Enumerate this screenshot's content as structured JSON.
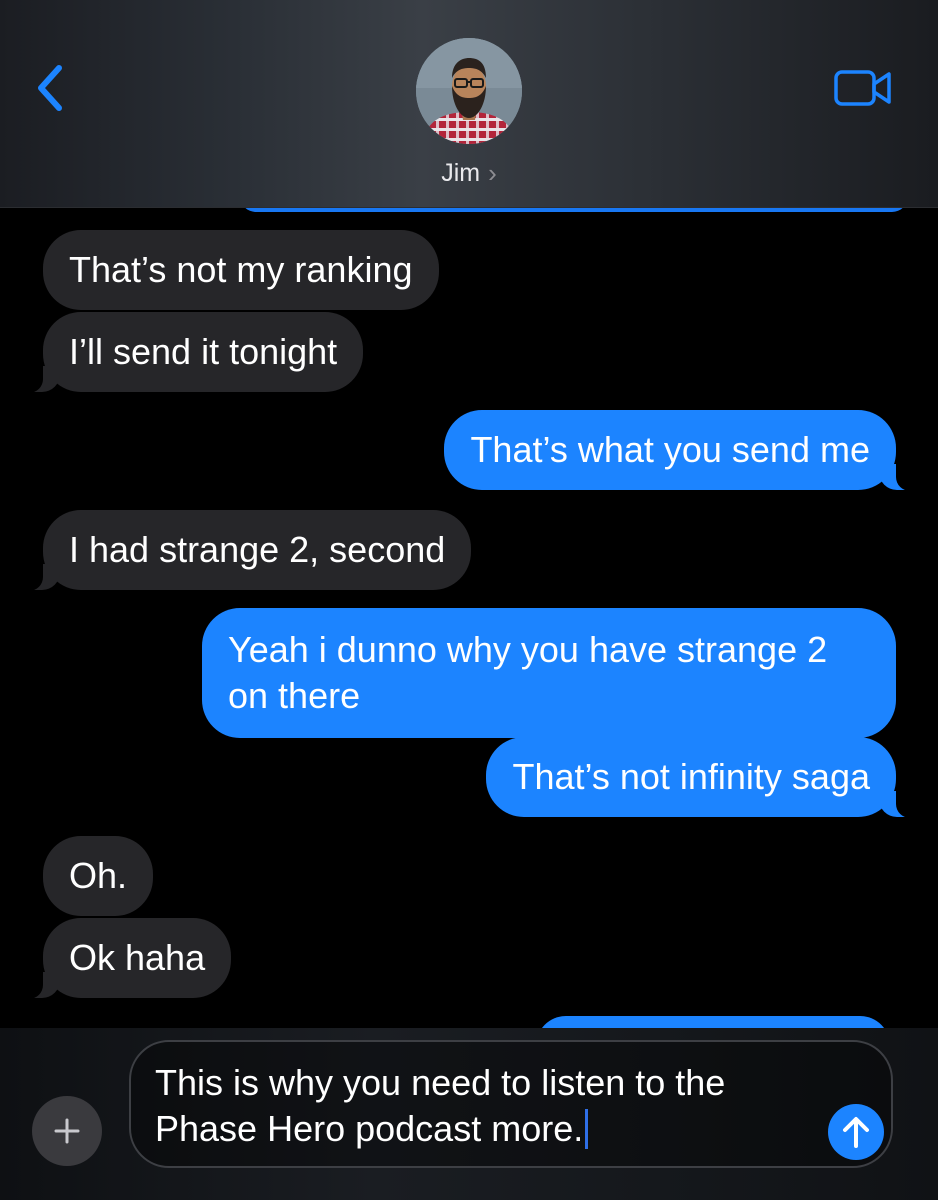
{
  "header": {
    "contact_name": "Jim",
    "chevron": "›",
    "back_icon": "chevron-left-icon",
    "video_icon": "video-camera-icon",
    "accent_color": "#1c84ff"
  },
  "messages": [
    {
      "direction": "incoming",
      "text": "That’s not my ranking"
    },
    {
      "direction": "incoming",
      "text": "I’ll send it tonight"
    },
    {
      "direction": "outgoing",
      "text": "That’s what you send me"
    },
    {
      "direction": "incoming",
      "text": "I had strange 2, second"
    },
    {
      "direction": "outgoing",
      "text": "Yeah i dunno why you have strange 2 on there"
    },
    {
      "direction": "outgoing",
      "text": "That’s not infinity saga"
    },
    {
      "direction": "incoming",
      "text": "Oh."
    },
    {
      "direction": "incoming",
      "text": "Ok haha"
    }
  ],
  "compose": {
    "value": "This is why you need to listen to the Phase Hero podcast more.",
    "plus_icon": "plus-icon",
    "send_icon": "arrow-up-icon"
  },
  "colors": {
    "incoming_bubble": "#262629",
    "outgoing_bubble": "#1c84ff",
    "background": "#000000"
  }
}
